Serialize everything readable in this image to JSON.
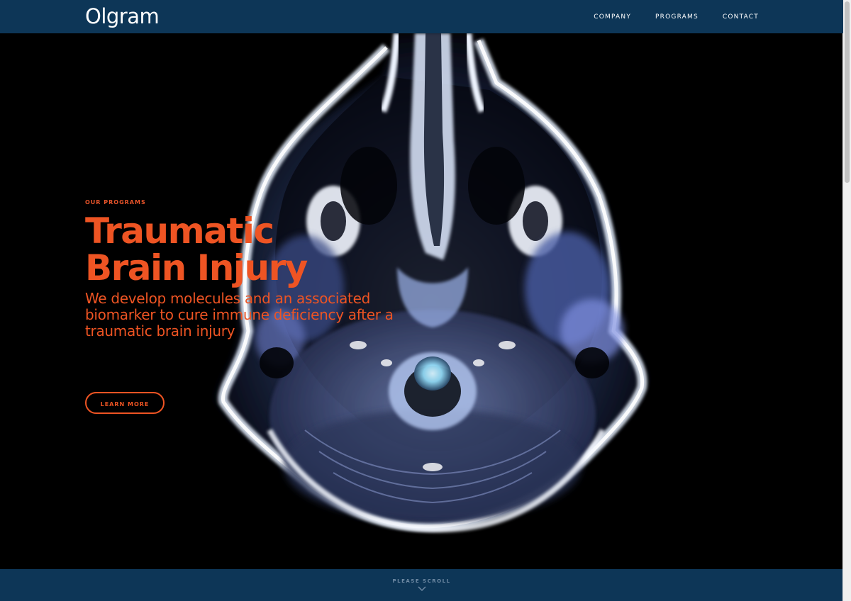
{
  "header": {
    "logo": "Olgram",
    "nav": [
      {
        "label": "COMPANY"
      },
      {
        "label": "PROGRAMS"
      },
      {
        "label": "CONTACT"
      }
    ]
  },
  "hero": {
    "eyebrow": "OUR PROGRAMS",
    "headline_line1": "Traumatic",
    "headline_line2": "Brain Injury",
    "subhead": "We develop molecules and an associated biomarker to cure immune deficiency after a traumatic brain injury",
    "cta_label": "LEARN MORE",
    "background_image": "mri-brain-scan"
  },
  "footer": {
    "scroll_label": "PLEASE SCROLL",
    "scroll_icon": "chevron-down-icon"
  },
  "colors": {
    "header_bg": "#0d3657",
    "accent": "#ee5423",
    "hero_bg": "#000000"
  }
}
